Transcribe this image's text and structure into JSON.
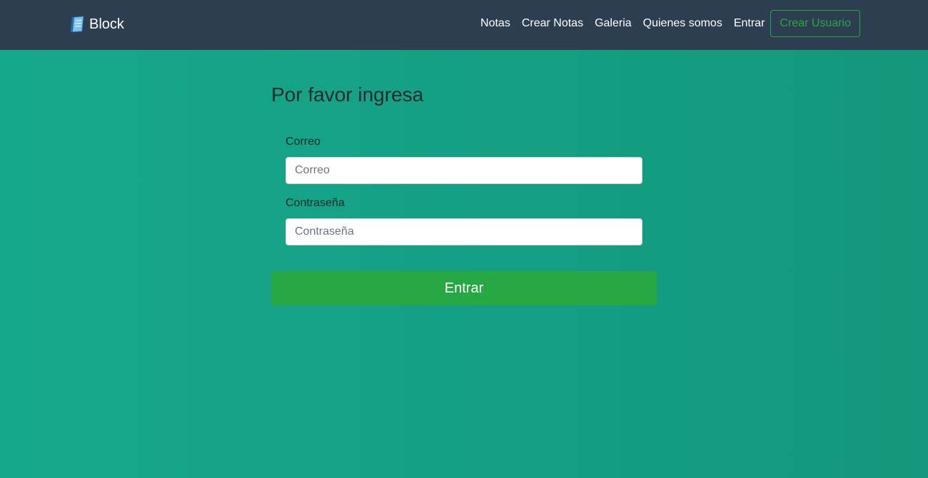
{
  "nav": {
    "brand": "Block",
    "brand_icon": "notebook-icon",
    "links": [
      "Notas",
      "Crear Notas",
      "Galeria",
      "Quienes somos",
      "Entrar"
    ],
    "signup_button": "Crear Usuario"
  },
  "form": {
    "title": "Por favor ingresa",
    "email_label": "Correo",
    "email_placeholder": "Correo",
    "email_value": "",
    "password_label": "Contraseña",
    "password_placeholder": "Contraseña",
    "password_value": "",
    "submit_label": "Entrar"
  },
  "colors": {
    "navbar": "#2c3e50",
    "background_start": "#16a88b",
    "background_end": "#13977c",
    "accent_green": "#28a745"
  }
}
